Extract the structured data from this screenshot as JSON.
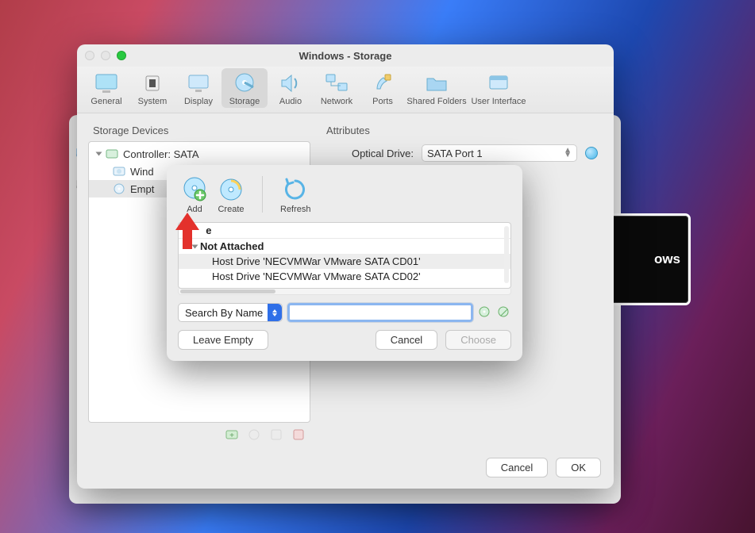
{
  "bg_preview_text": "ows",
  "window": {
    "title": "Windows - Storage",
    "toolbar": [
      {
        "label": "General"
      },
      {
        "label": "System"
      },
      {
        "label": "Display"
      },
      {
        "label": "Storage"
      },
      {
        "label": "Audio"
      },
      {
        "label": "Network"
      },
      {
        "label": "Ports"
      },
      {
        "label": "Shared Folders"
      },
      {
        "label": "User Interface"
      }
    ],
    "selected_tab_index": 3,
    "left_panel_title": "Storage Devices",
    "tree": {
      "controller": "Controller: SATA",
      "items": [
        {
          "label": "Windows Disk",
          "visible": "Wind"
        },
        {
          "label": "Empty",
          "visible": "Empt"
        }
      ],
      "selected_index": 1
    },
    "right_panel_title": "Attributes",
    "attr": {
      "optical_label": "Optical Drive:",
      "optical_value": "SATA Port 1"
    },
    "buttons": {
      "cancel": "Cancel",
      "ok": "OK"
    }
  },
  "sheet": {
    "toolbar": {
      "add": "Add",
      "create": "Create",
      "refresh": "Refresh"
    },
    "list": {
      "header": "Name",
      "header_visible_fragment": "e",
      "category": "Not Attached",
      "rows": [
        "Host Drive 'NECVMWar VMware SATA CD01'",
        "Host Drive 'NECVMWar VMware SATA CD02'"
      ],
      "selected_row_index": 0
    },
    "search": {
      "mode_label": "Search By Name",
      "value": ""
    },
    "buttons": {
      "leave_empty": "Leave Empty",
      "cancel": "Cancel",
      "choose": "Choose"
    }
  }
}
